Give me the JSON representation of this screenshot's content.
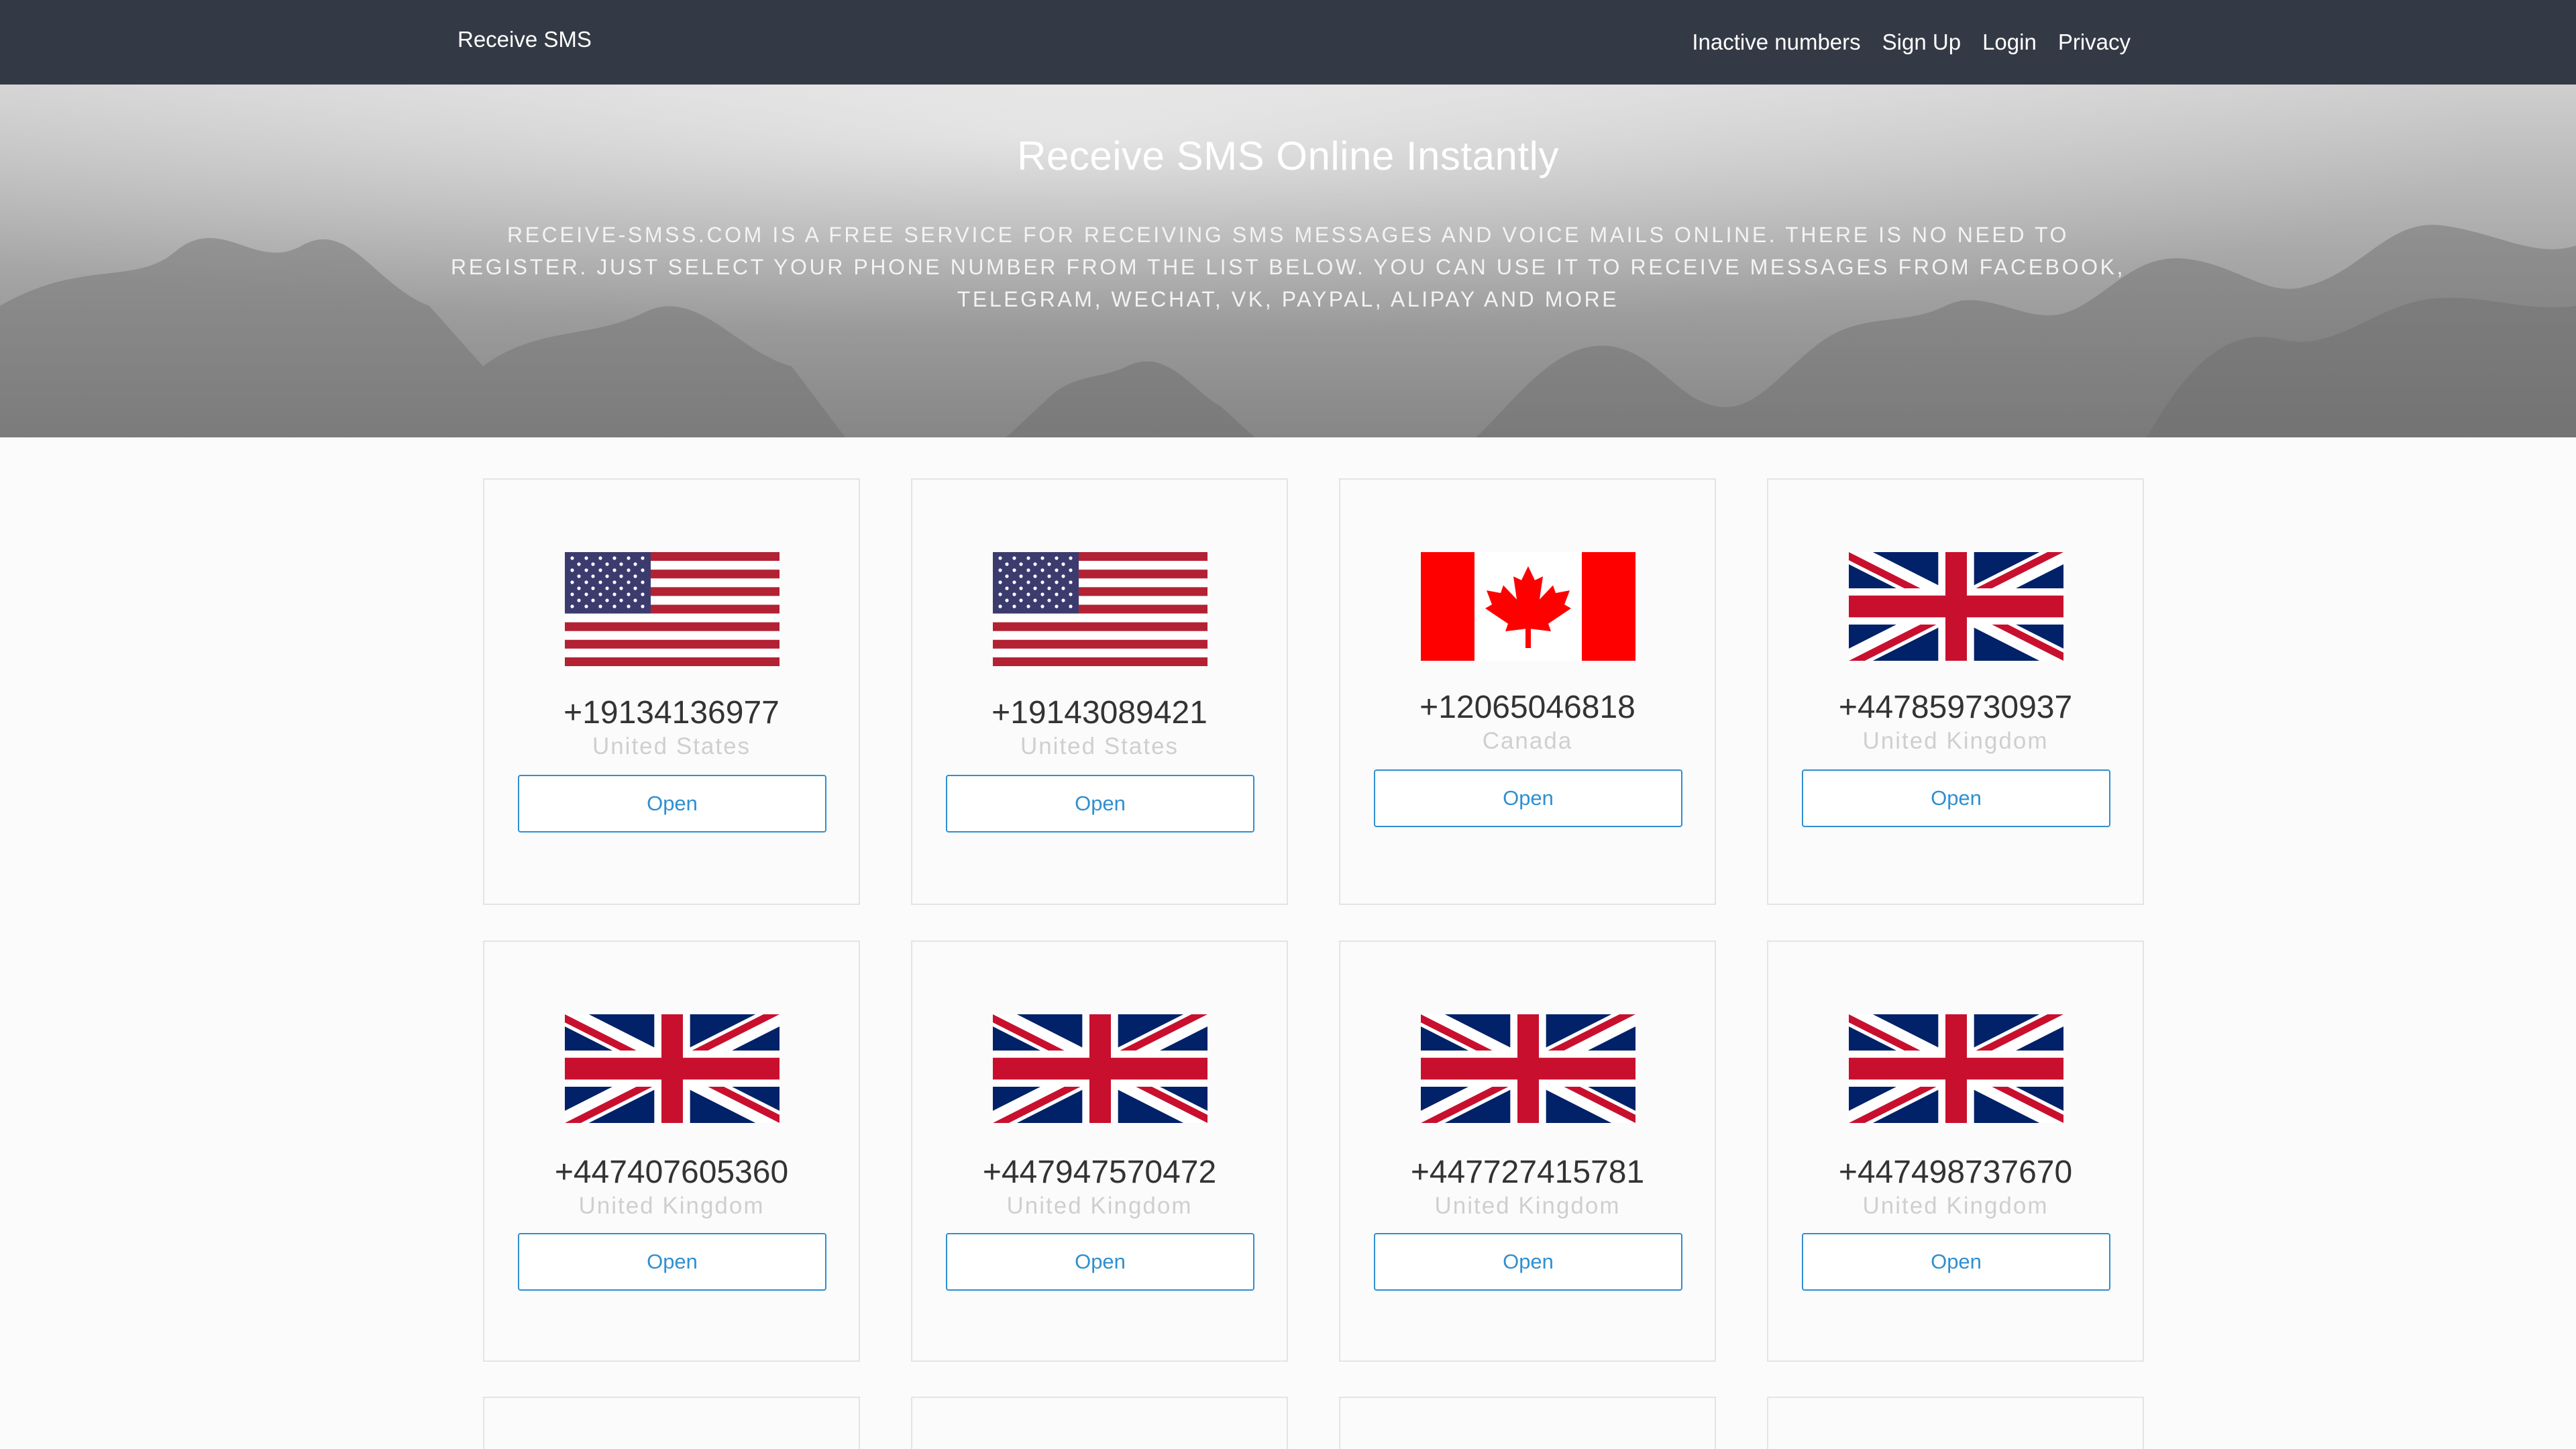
{
  "navbar": {
    "brand": "Receive SMS",
    "links": [
      "Inactive numbers",
      "Sign Up",
      "Login",
      "Privacy"
    ]
  },
  "hero": {
    "title": "Receive SMS Online Instantly",
    "description": "RECEIVE-SMSS.COM IS A FREE SERVICE FOR RECEIVING SMS MESSAGES AND VOICE MAILS ONLINE. THERE IS NO NEED TO REGISTER. JUST SELECT YOUR PHONE NUMBER FROM THE LIST BELOW. YOU CAN USE IT TO RECEIVE MESSAGES FROM FACEBOOK, TELEGRAM, WECHAT, VK, PAYPAL, ALIPAY AND MORE"
  },
  "numbers": [
    {
      "number": "+19134136977",
      "country": "United States",
      "flag": "us-flag-icon",
      "button": "Open"
    },
    {
      "number": "+19143089421",
      "country": "United States",
      "flag": "us-flag-icon",
      "button": "Open"
    },
    {
      "number": "+12065046818",
      "country": "Canada",
      "flag": "canada-flag-icon",
      "button": "Open"
    },
    {
      "number": "+447859730937",
      "country": "United Kingdom",
      "flag": "uk-flag-icon",
      "button": "Open"
    },
    {
      "number": "+447407605360",
      "country": "United Kingdom",
      "flag": "uk-flag-icon",
      "button": "Open"
    },
    {
      "number": "+447947570472",
      "country": "United Kingdom",
      "flag": "uk-flag-icon",
      "button": "Open"
    },
    {
      "number": "+447727415781",
      "country": "United Kingdom",
      "flag": "uk-flag-icon",
      "button": "Open"
    },
    {
      "number": "+447498737670",
      "country": "United Kingdom",
      "flag": "uk-flag-icon",
      "button": "Open"
    }
  ],
  "colors": {
    "navbar": "#343a45",
    "accent": "#2f8fd0",
    "us_red": "#b22234",
    "us_blue": "#3c3b6e",
    "canada_red": "#ff0000",
    "uk_blue": "#012169",
    "uk_red": "#c8102e"
  }
}
